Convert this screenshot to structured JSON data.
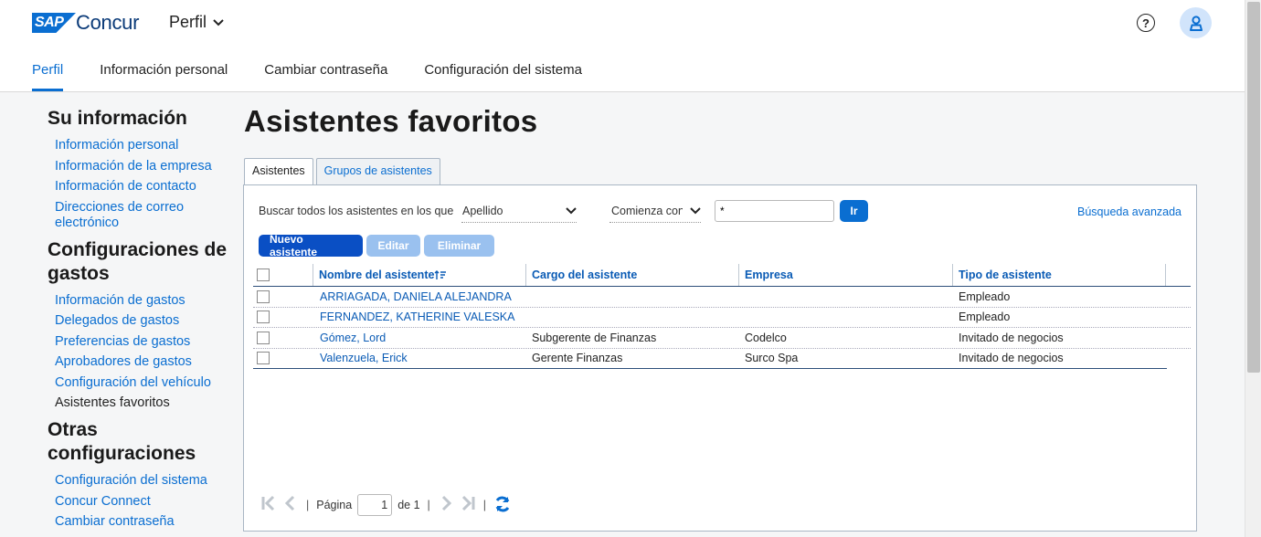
{
  "header": {
    "brand_sap": "SAP",
    "brand_concur": "Concur",
    "profile_menu": "Perfil",
    "help_glyph": "?"
  },
  "nav": {
    "tabs": [
      {
        "label": "Perfil",
        "active": true
      },
      {
        "label": "Información personal"
      },
      {
        "label": "Cambiar contraseña"
      },
      {
        "label": "Configuración del sistema"
      }
    ]
  },
  "sidebar": {
    "sections": [
      {
        "heading": "Su información",
        "links": [
          "Información personal",
          "Información de la empresa",
          "Información de contacto",
          "Direcciones de correo electrónico"
        ]
      },
      {
        "heading": "Configuraciones de gastos",
        "links": [
          "Información de gastos",
          "Delegados de gastos",
          "Preferencias de gastos",
          "Aprobadores de gastos",
          "Configuración del vehículo",
          "Asistentes favoritos"
        ]
      },
      {
        "heading": "Otras configuraciones",
        "links": [
          "Configuración del sistema",
          "Concur Connect",
          "Cambiar contraseña"
        ]
      }
    ]
  },
  "main": {
    "title": "Asistentes favoritos",
    "tabs": [
      "Asistentes",
      "Grupos de asistentes"
    ],
    "search": {
      "label": "Buscar todos los asistentes en los que",
      "field_select": "Apellido",
      "operator_select": "Comienza con",
      "value": "*",
      "go_label": "Ir",
      "advanced_label": "Búsqueda avanzada"
    },
    "actions": {
      "new_label": "Nuevo asistente",
      "edit_label": "Editar",
      "delete_label": "Eliminar"
    },
    "table": {
      "columns": [
        "Nombre del asistente",
        "Cargo del asistente",
        "Empresa",
        "Tipo de asistente"
      ],
      "rows": [
        {
          "name": "ARRIAGADA, DANIELA ALEJANDRA",
          "title": "",
          "company": "",
          "type": "Empleado"
        },
        {
          "name": "FERNANDEZ, KATHERINE VALESKA",
          "title": "",
          "company": "",
          "type": "Empleado"
        },
        {
          "name": "Gómez, Lord",
          "title": "Subgerente de Finanzas",
          "company": "Codelco",
          "type": "Invitado de negocios"
        },
        {
          "name": "Valenzuela, Erick",
          "title": "Gerente Finanzas",
          "company": "Surco Spa",
          "type": "Invitado de negocios"
        }
      ]
    },
    "pager": {
      "page_label": "Página",
      "page_value": "1",
      "of_label": "de 1"
    }
  },
  "colors": {
    "accent": "#0a6ed1",
    "primary_button": "#0a4fc4",
    "disabled_button": "#9ac1ef"
  }
}
